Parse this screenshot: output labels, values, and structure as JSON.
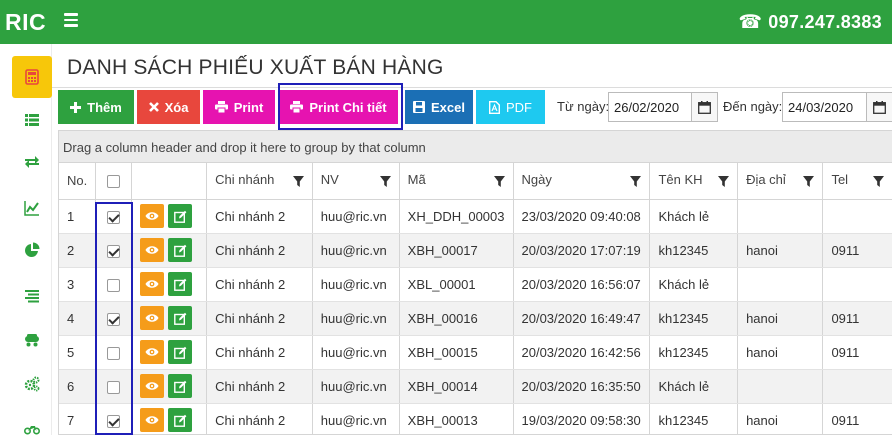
{
  "header": {
    "brand": "RIC",
    "phone": "097.247.8383"
  },
  "page": {
    "title": "DANH SÁCH PHIẾU XUẤT BÁN HÀNG"
  },
  "toolbar": {
    "add_label": "Thêm",
    "delete_label": "Xóa",
    "print_label": "Print",
    "print_detail_label": "Print Chi tiết",
    "excel_label": "Excel",
    "pdf_label": "PDF",
    "from_label": "Từ ngày:",
    "from_value": "26/02/2020",
    "to_label": "Đến ngày:",
    "to_value": "24/03/2020"
  },
  "grid": {
    "group_hint": "Drag a column header and drop it here to group by that column",
    "columns": {
      "no": "No.",
      "branch": "Chi nhánh",
      "staff": "NV",
      "code": "Mã",
      "date": "Ngày",
      "customer": "Tên KH",
      "address": "Địa chỉ",
      "tel": "Tel"
    },
    "rows": [
      {
        "no": "1",
        "checked": true,
        "branch": "Chi nhánh 2",
        "staff": "huu@ric.vn",
        "code": "XH_DDH_00003",
        "date": "23/03/2020 09:40:08",
        "customer": "Khách lẻ",
        "address": "",
        "tel": ""
      },
      {
        "no": "2",
        "checked": true,
        "branch": "Chi nhánh 2",
        "staff": "huu@ric.vn",
        "code": "XBH_00017",
        "date": "20/03/2020 17:07:19",
        "customer": "kh12345",
        "address": "hanoi",
        "tel": "0911"
      },
      {
        "no": "3",
        "checked": false,
        "branch": "Chi nhánh 2",
        "staff": "huu@ric.vn",
        "code": "XBL_00001",
        "date": "20/03/2020 16:56:07",
        "customer": "Khách lẻ",
        "address": "",
        "tel": ""
      },
      {
        "no": "4",
        "checked": true,
        "branch": "Chi nhánh 2",
        "staff": "huu@ric.vn",
        "code": "XBH_00016",
        "date": "20/03/2020 16:49:47",
        "customer": "kh12345",
        "address": "hanoi",
        "tel": "0911"
      },
      {
        "no": "5",
        "checked": false,
        "branch": "Chi nhánh 2",
        "staff": "huu@ric.vn",
        "code": "XBH_00015",
        "date": "20/03/2020 16:42:56",
        "customer": "kh12345",
        "address": "hanoi",
        "tel": "0911"
      },
      {
        "no": "6",
        "checked": false,
        "branch": "Chi nhánh 2",
        "staff": "huu@ric.vn",
        "code": "XBH_00014",
        "date": "20/03/2020 16:35:50",
        "customer": "Khách lẻ",
        "address": "",
        "tel": ""
      },
      {
        "no": "7",
        "checked": true,
        "branch": "Chi nhánh 2",
        "staff": "huu@ric.vn",
        "code": "XBH_00013",
        "date": "19/03/2020 09:58:30",
        "customer": "kh12345",
        "address": "hanoi",
        "tel": "0911"
      }
    ]
  },
  "colors": {
    "green": "#2ea13f",
    "red": "#e8473d",
    "magenta": "#e613b0",
    "blue": "#1b6fb5",
    "cyan": "#1ec9f0",
    "orange": "#f59c1a",
    "yellow": "#f7c70a",
    "highlight": "#1f1fb8"
  },
  "icons": [
    "hamburger-icon",
    "phone-icon",
    "calculator-icon",
    "list-icon",
    "transfer-icon",
    "line-chart-icon",
    "pie-chart-icon",
    "align-icon",
    "truck-icon",
    "cogs-icon",
    "motorbike-icon",
    "plus-icon",
    "times-icon",
    "print-icon",
    "save-icon",
    "pdf-icon",
    "calendar-icon",
    "filter-icon",
    "eye-icon",
    "edit-icon"
  ]
}
